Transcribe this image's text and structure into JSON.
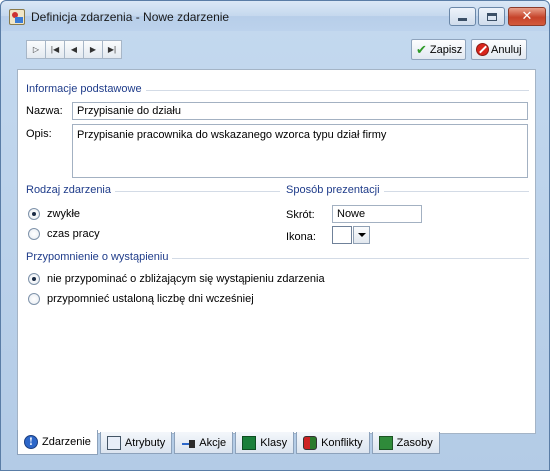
{
  "window": {
    "title": "Definicja zdarzenia - Nowe zdarzenie",
    "min_icon": "minimize-icon",
    "max_icon": "maximize-icon",
    "close_icon": "close-icon"
  },
  "toolbar": {
    "nav_icons": [
      "new-icon",
      "first-icon",
      "previous-icon",
      "next-icon",
      "last-icon"
    ],
    "save_label": "Zapisz",
    "cancel_label": "Anuluj"
  },
  "basic": {
    "section_title": "Informacje podstawowe",
    "name_label": "Nazwa:",
    "name_value": "Przypisanie do działu",
    "desc_label": "Opis:",
    "desc_value": "Przypisanie pracownika do wskazanego wzorca typu dział firmy"
  },
  "event_type": {
    "section_title": "Rodzaj zdarzenia",
    "options": [
      "zwykłe",
      "czas pracy"
    ],
    "selected": 0
  },
  "presentation": {
    "section_title": "Sposób prezentacji",
    "short_label": "Skrót:",
    "short_value": "Nowe",
    "icon_label": "Ikona:"
  },
  "reminder": {
    "section_title": "Przypomnienie o wystąpieniu",
    "options": [
      "nie przypominać o zbliżającym się wystąpieniu zdarzenia",
      "przypomnieć ustaloną liczbę dni wcześniej"
    ],
    "selected": 0
  },
  "tabs": [
    {
      "label": "Zdarzenie",
      "icon": "info-icon",
      "active": true
    },
    {
      "label": "Atrybuty",
      "icon": "attributes-icon",
      "active": false
    },
    {
      "label": "Akcje",
      "icon": "actions-icon",
      "active": false
    },
    {
      "label": "Klasy",
      "icon": "classes-icon",
      "active": false
    },
    {
      "label": "Konflikty",
      "icon": "conflicts-icon",
      "active": false
    },
    {
      "label": "Zasoby",
      "icon": "resources-icon",
      "active": false
    }
  ],
  "colors": {
    "section_title": "#1f3c8a",
    "close_button": "#c6432a",
    "save_check": "#2e9a27",
    "cancel_red": "#d9251c"
  }
}
